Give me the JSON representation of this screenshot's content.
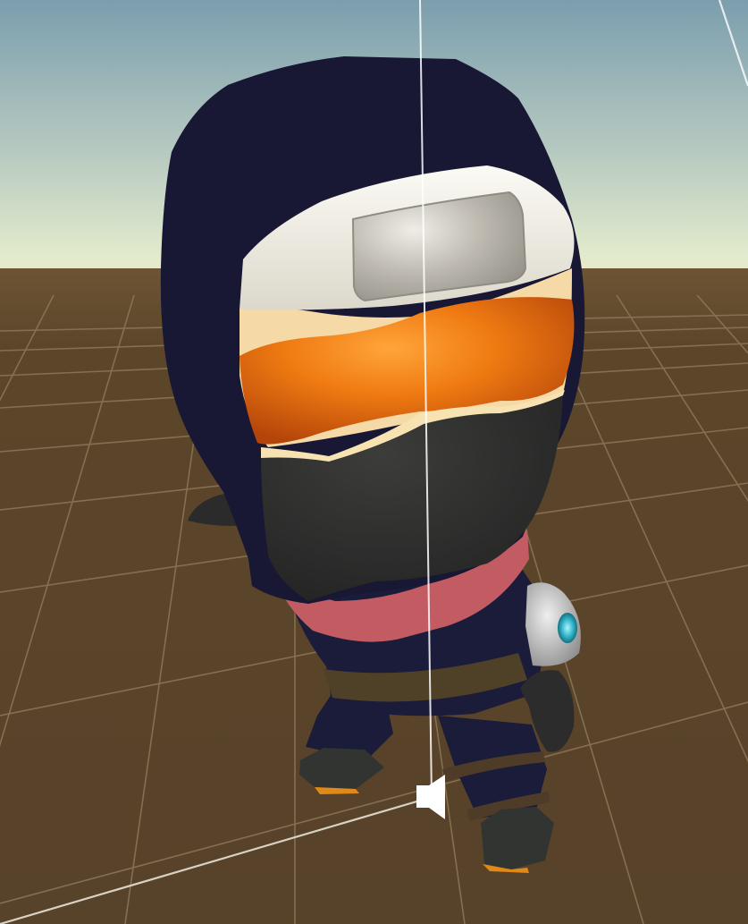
{
  "scene": {
    "view": "3d-scene-viewport",
    "character": "chibi-ninja",
    "props": [
      "headband-plate",
      "orange-goggles",
      "face-mask",
      "red-scarf",
      "belt",
      "shoulder-armor",
      "gloves",
      "boots"
    ],
    "gizmos": [
      "audio-source-icon",
      "vertical-guide-line"
    ]
  },
  "colors": {
    "sky_top": "#7fa2b2",
    "sky_horizon": "#dde8c9",
    "ground": "#5a4427",
    "grid_line": "#8a7556",
    "hood": "#181734",
    "headband": "#ece9de",
    "plate": "#b8b4ab",
    "skin": "#f5d9a5",
    "goggles": "#e8710f",
    "mask": "#2f302f",
    "scarf": "#c45e63",
    "belt": "#4f4028",
    "body": "#1a1a38",
    "glove": "#2a2b2a",
    "armor": "#c8c8c8",
    "gem": "#38b7c9",
    "gizmo": "#ffffff"
  }
}
